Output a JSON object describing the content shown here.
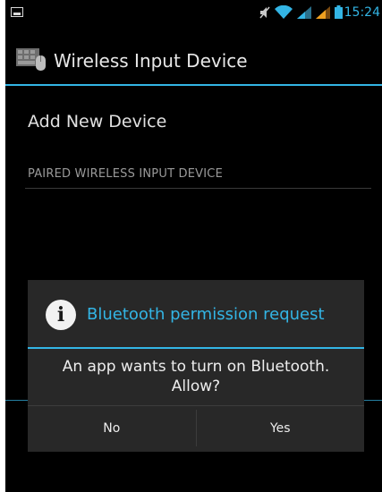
{
  "status_bar": {
    "time": "15:24",
    "icons": [
      "image-notification-icon",
      "mute-icon",
      "wifi-icon",
      "signal-icon",
      "signal-icon",
      "battery-icon"
    ]
  },
  "action_bar": {
    "title": "Wireless Input Device",
    "icon": "keyboard-mouse-icon"
  },
  "content": {
    "add_device_label": "Add New Device",
    "section_header": "PAIRED WIRELESS INPUT DEVICE"
  },
  "dialog": {
    "icon": "info-icon",
    "title": "Bluetooth permission request",
    "message": "An app wants to turn on Bluetooth. Allow?",
    "no_label": "No",
    "yes_label": "Yes"
  },
  "colors": {
    "accent": "#33b5e5",
    "background": "#000000",
    "dialog_background": "#282828",
    "signal_orange": "#f0a020"
  }
}
